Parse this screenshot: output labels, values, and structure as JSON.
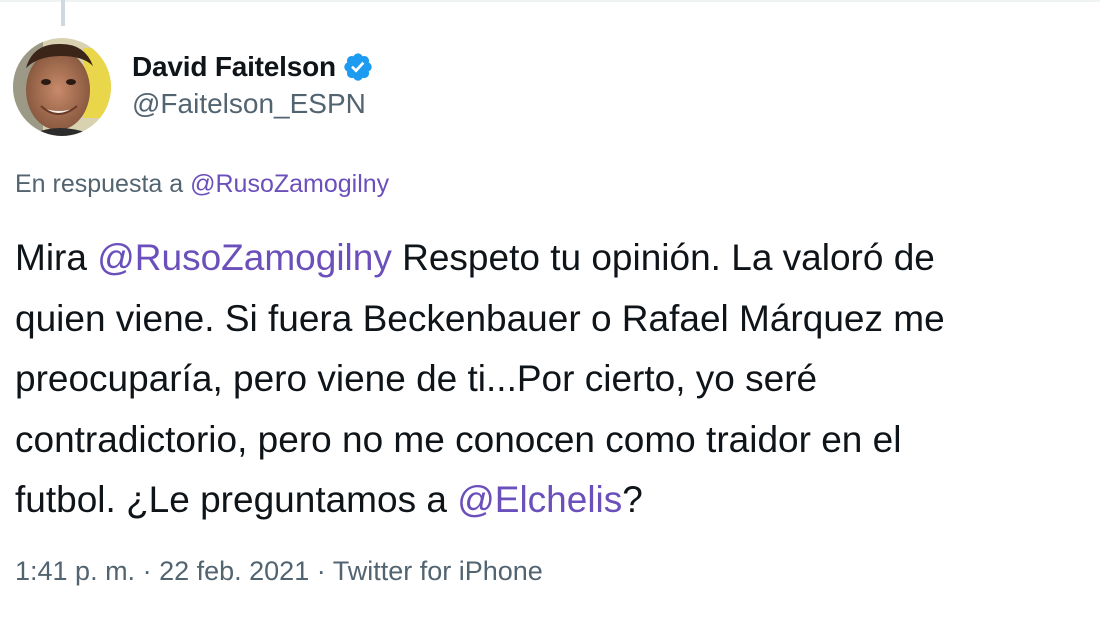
{
  "tweet": {
    "author": {
      "display_name": "David Faitelson",
      "handle": "@Faitelson_ESPN",
      "verified": true,
      "avatar_icon": "profile-photo"
    },
    "reply_to": {
      "prefix": "En respuesta a ",
      "mention": "@RusoZamogilny"
    },
    "text_lines": [
      {
        "parts": [
          "Mira ",
          "@RusoZamogilny",
          " Respeto tu opinión. La valoró de"
        ]
      },
      {
        "parts": [
          "quien viene. Si fuera Beckenbauer o Rafael Márquez me"
        ]
      },
      {
        "parts": [
          "preocuparía, pero viene de ti...Por cierto, yo seré"
        ]
      },
      {
        "parts": [
          "contradictorio, pero no me conocen como traidor en el"
        ]
      },
      {
        "parts": [
          "futbol. ¿Le preguntamos a ",
          "@Elchelis",
          "?"
        ]
      }
    ],
    "meta": {
      "time": "1:41 p. m.",
      "separator1": " · ",
      "date": "22 feb. 2021",
      "separator2": " · ",
      "source": "Twitter for iPhone"
    }
  },
  "colors": {
    "mention": "#6b4fbb",
    "secondary_text": "#536471",
    "primary_text": "#0f1419",
    "verified_badge": "#1d9bf0"
  }
}
